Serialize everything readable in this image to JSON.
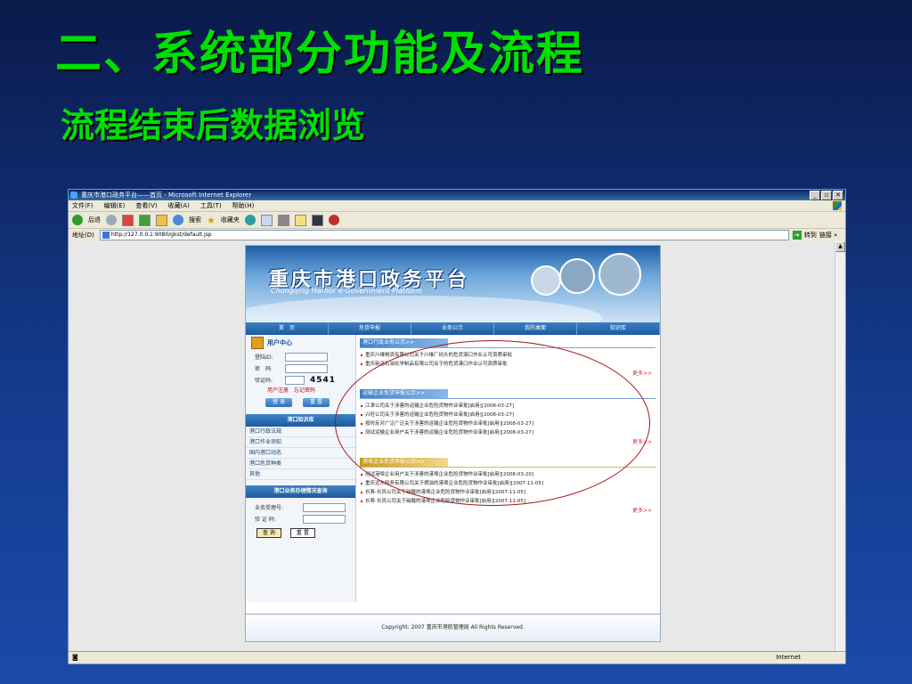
{
  "slide": {
    "title": "二、系统部分功能及流程",
    "subtitle": "流程结束后数据浏览"
  },
  "browser": {
    "window_title": "重庆市港口政务平台——首页 - Microsoft Internet Explorer",
    "window_buttons": [
      "_",
      "▫",
      "✕"
    ],
    "menu": [
      "文件(F)",
      "编辑(E)",
      "查看(V)",
      "收藏(A)",
      "工具(T)",
      "帮助(H)"
    ],
    "toolbar": {
      "back": "后退",
      "search": "搜索",
      "favorites": "收藏夹"
    },
    "address": {
      "label": "地址(D)",
      "url": "http://127.0.0.1:9080/gkst/default.jsp",
      "go": "转到",
      "links": "链接 »"
    },
    "status": {
      "zone": "Internet"
    }
  },
  "site": {
    "title": "重庆市港口政务平台",
    "subtitle": "Chongqing Harbor e-Government Platform",
    "nav": [
      "首　页",
      "危货申报",
      "业务公示",
      "我的桌面",
      "知识库"
    ],
    "user_center": {
      "heading": "用户中心",
      "login_label": "登陆ID:",
      "password_label": "密　码:",
      "captcha_label": "验证码:",
      "captcha_value": "4541",
      "register": "用户注册",
      "forgot": "忘记密码",
      "login_btn": "登 录",
      "reset_btn": "重 置"
    },
    "knowledge": {
      "heading": "港口知识库",
      "items": [
        "港口行政法规",
        "港口作业须知",
        "国内港口动态",
        "港口危货种类",
        "其他"
      ]
    },
    "query": {
      "heading": "港口业务办理情况查询",
      "accept_no": "业务受理号:",
      "verify_code": "验 证 码:",
      "query_btn": "查 询",
      "reset_btn": "重 置"
    },
    "sections": [
      {
        "title": "港口行政业务公示>>",
        "items": [
          "重庆川维物流有限公司关于川维厂码头的危货港口作业认可资质审批",
          "重庆新涪石油化学制品有限公司关于的危货港口作业认可资质审批"
        ],
        "more": "更多>>"
      },
      {
        "title": "运输企业危货申报公示>>",
        "items": [
          "江津公司关于涉害的运输企业危险货物作业审批[启用][2008-03-27]",
          "兴旺公司关于涉害的运输企业危险货物作业审批[启用][2008-03-27]",
          "按时反对广泛广泛关于涉害的运输企业危险货物作业审批[启用][2008-03-27]",
          "测试运输企业用户关于涉害的运输企业危险货物作业审批[启用][2008-03-27]"
        ],
        "more": "更多>>"
      },
      {
        "title": "港埠企业危货申报公示>>",
        "items": [
          "测试港埠企业用户关于涉害的港埠企业危险货物作业审批[启用][2008-03-20]",
          "重庆远东船务有限公司关于燃油的港埠企业危险货物作业审批[启用][2007-11-05]",
          "长寿-长风公司关于硝酸的港埠企业危险货物作业审批[启用][2007-11-05]",
          "长寿-长风公司关于硝酸的港埠企业危险货物作业审批[启用][2007-11-05]"
        ],
        "more": "更多>>"
      }
    ],
    "footer": "Copyright: 2007 重庆市港航管理局 All Rights Reserved."
  }
}
